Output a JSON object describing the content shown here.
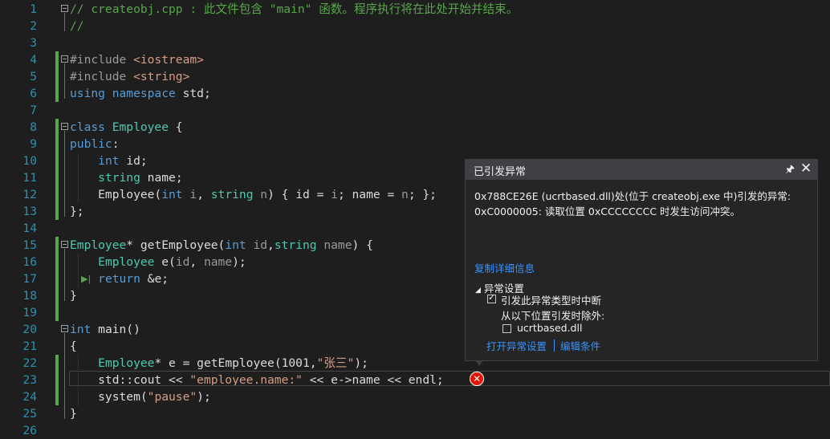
{
  "editor": {
    "lines": [
      {
        "num": "1",
        "tokens": [
          {
            "t": "// createobj.cpp : 此文件包含 \"main\" 函数。程序执行将在此处开始并结束。",
            "c": "cm"
          }
        ]
      },
      {
        "num": "2",
        "tokens": [
          {
            "t": "//",
            "c": "cm"
          }
        ]
      },
      {
        "num": "3",
        "tokens": []
      },
      {
        "num": "4",
        "tokens": [
          {
            "t": "#include ",
            "c": "pp"
          },
          {
            "t": "<iostream>",
            "c": "inc"
          }
        ]
      },
      {
        "num": "5",
        "tokens": [
          {
            "t": "#include ",
            "c": "pp"
          },
          {
            "t": "<string>",
            "c": "inc"
          }
        ]
      },
      {
        "num": "6",
        "tokens": [
          {
            "t": "using ",
            "c": "kw"
          },
          {
            "t": "namespace ",
            "c": "kw"
          },
          {
            "t": "std;",
            "c": ""
          }
        ]
      },
      {
        "num": "7",
        "tokens": []
      },
      {
        "num": "8",
        "tokens": [
          {
            "t": "class ",
            "c": "kw"
          },
          {
            "t": "Employee",
            "c": "ty"
          },
          {
            "t": " {",
            "c": ""
          }
        ]
      },
      {
        "num": "9",
        "tokens": [
          {
            "t": "public",
            "c": "kw"
          },
          {
            "t": ":",
            "c": ""
          }
        ]
      },
      {
        "num": "10",
        "tokens": [
          {
            "t": "    ",
            "c": ""
          },
          {
            "t": "int ",
            "c": "kw"
          },
          {
            "t": "id;",
            "c": ""
          }
        ]
      },
      {
        "num": "11",
        "tokens": [
          {
            "t": "    ",
            "c": ""
          },
          {
            "t": "string ",
            "c": "ty"
          },
          {
            "t": "name;",
            "c": ""
          }
        ]
      },
      {
        "num": "12",
        "tokens": [
          {
            "t": "    Employee(",
            "c": ""
          },
          {
            "t": "int ",
            "c": "kw"
          },
          {
            "t": "i",
            "c": "param"
          },
          {
            "t": ", ",
            "c": ""
          },
          {
            "t": "string ",
            "c": "ty"
          },
          {
            "t": "n",
            "c": "param"
          },
          {
            "t": ") { id = ",
            "c": ""
          },
          {
            "t": "i",
            "c": "param"
          },
          {
            "t": "; name = ",
            "c": ""
          },
          {
            "t": "n",
            "c": "param"
          },
          {
            "t": "; };",
            "c": ""
          }
        ]
      },
      {
        "num": "13",
        "tokens": [
          {
            "t": "};",
            "c": ""
          }
        ]
      },
      {
        "num": "14",
        "tokens": []
      },
      {
        "num": "15",
        "tokens": [
          {
            "t": "Employee",
            "c": "ty"
          },
          {
            "t": "* getEmployee(",
            "c": ""
          },
          {
            "t": "int ",
            "c": "kw"
          },
          {
            "t": "id",
            "c": "param"
          },
          {
            "t": ",",
            "c": ""
          },
          {
            "t": "string ",
            "c": "ty"
          },
          {
            "t": "name",
            "c": "param"
          },
          {
            "t": ") {",
            "c": ""
          }
        ]
      },
      {
        "num": "16",
        "tokens": [
          {
            "t": "    ",
            "c": ""
          },
          {
            "t": "Employee ",
            "c": "ty"
          },
          {
            "t": "e(",
            "c": ""
          },
          {
            "t": "id",
            "c": "param"
          },
          {
            "t": ", ",
            "c": ""
          },
          {
            "t": "name",
            "c": "param"
          },
          {
            "t": ");",
            "c": ""
          }
        ]
      },
      {
        "num": "17",
        "tokens": [
          {
            "t": "    ",
            "c": ""
          },
          {
            "t": "return ",
            "c": "kw"
          },
          {
            "t": "&e;",
            "c": ""
          }
        ]
      },
      {
        "num": "18",
        "tokens": [
          {
            "t": "}",
            "c": ""
          }
        ]
      },
      {
        "num": "19",
        "tokens": []
      },
      {
        "num": "20",
        "tokens": [
          {
            "t": "int ",
            "c": "kw"
          },
          {
            "t": "main()",
            "c": ""
          }
        ]
      },
      {
        "num": "21",
        "tokens": [
          {
            "t": "{",
            "c": ""
          }
        ]
      },
      {
        "num": "22",
        "tokens": [
          {
            "t": "    ",
            "c": ""
          },
          {
            "t": "Employee",
            "c": "ty"
          },
          {
            "t": "* e = getEmployee(1001,",
            "c": ""
          },
          {
            "t": "\"张三\"",
            "c": "str"
          },
          {
            "t": ");",
            "c": ""
          }
        ]
      },
      {
        "num": "23",
        "tokens": [
          {
            "t": "    std::cout << ",
            "c": ""
          },
          {
            "t": "\"employee.name:\"",
            "c": "str"
          },
          {
            "t": " << e->name << endl;",
            "c": ""
          }
        ]
      },
      {
        "num": "24",
        "tokens": [
          {
            "t": "    system(",
            "c": ""
          },
          {
            "t": "\"pause\"",
            "c": "str"
          },
          {
            "t": ");",
            "c": ""
          }
        ]
      },
      {
        "num": "25",
        "tokens": [
          {
            "t": "}",
            "c": ""
          }
        ]
      },
      {
        "num": "26",
        "tokens": []
      }
    ]
  },
  "exception_popup": {
    "title": "已引发异常",
    "message_line1": "0x788CE26E (ucrtbased.dll)处(位于 createobj.exe 中)引发的异常:",
    "message_line2": "0xC0000005: 读取位置 0xCCCCCCCC 时发生访问冲突。",
    "copy_details": "复制详细信息",
    "settings_header": "异常设置",
    "break_when_thrown": "引发此异常类型时中断",
    "except_when_from": "从以下位置引发时除外:",
    "module": "ucrtbased.dll",
    "open_settings": "打开异常设置",
    "edit_conditions": "编辑条件"
  }
}
